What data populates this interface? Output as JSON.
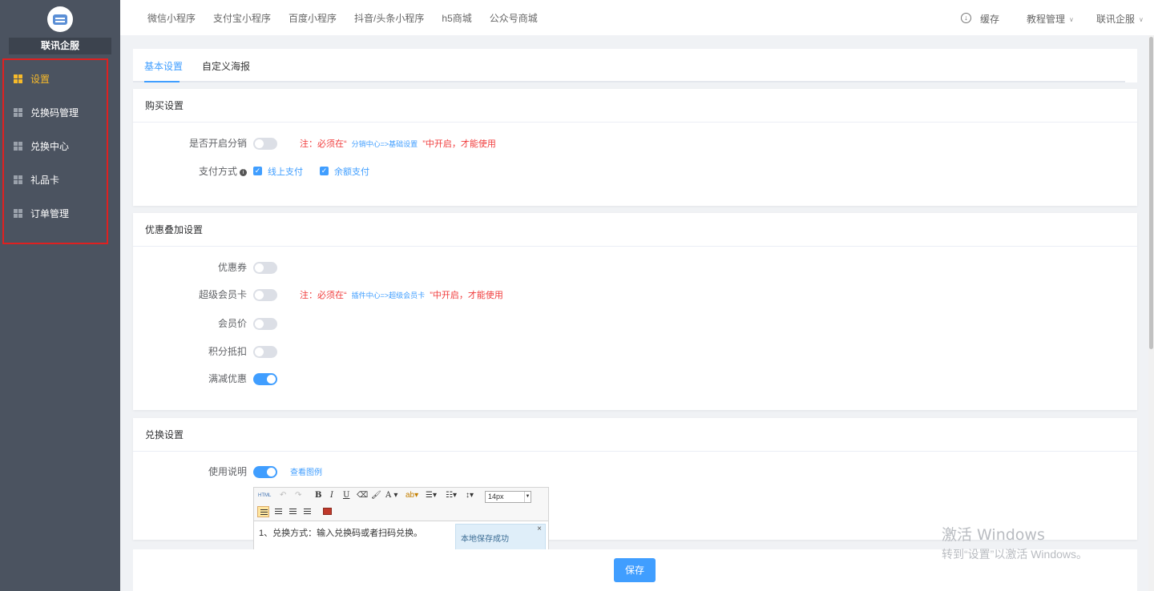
{
  "brand": {
    "name": "联讯企服"
  },
  "sidebar": {
    "items": [
      {
        "label": "设置",
        "active": true
      },
      {
        "label": "兑换码管理"
      },
      {
        "label": "兑换中心"
      },
      {
        "label": "礼品卡"
      },
      {
        "label": "订单管理"
      }
    ]
  },
  "topnav": [
    "微信小程序",
    "支付宝小程序",
    "百度小程序",
    "抖音/头条小程序",
    "h5商城",
    "公众号商城"
  ],
  "topright": {
    "cache": "缓存",
    "tutorial": "教程管理",
    "user": "联讯企服"
  },
  "tabs": [
    "基本设置",
    "自定义海报"
  ],
  "purchase": {
    "title": "购买设置",
    "distribution_label": "是否开启分销",
    "distribution_on": false,
    "note_prefix": "注：必须在“",
    "note_link": "分销中心=>基础设置",
    "note_suffix": "”中开启，才能使用",
    "pay_label": "支付方式",
    "pay_online": "线上支付",
    "pay_balance": "余额支付"
  },
  "discount": {
    "title": "优惠叠加设置",
    "rows": [
      {
        "label": "优惠券",
        "on": false
      },
      {
        "label": "超级会员卡",
        "on": false
      },
      {
        "label": "会员价",
        "on": false
      },
      {
        "label": "积分抵扣",
        "on": false
      },
      {
        "label": "满减优惠",
        "on": true
      }
    ],
    "note_prefix": "注：必须在“",
    "note_link": "插件中心=>超级会员卡",
    "note_suffix": "”中开启，才能使用"
  },
  "exchange": {
    "title": "兑换设置",
    "usage_label": "使用说明",
    "usage_on": true,
    "example_link": "查看图例",
    "editor": {
      "html_btn": "HTML",
      "font_size": "14px",
      "content": "1、兑换方式：输入兑换码或者扫码兑换。",
      "toast": "本地保存成功",
      "toast_close": "×"
    }
  },
  "footer": {
    "save": "保存"
  },
  "watermark": {
    "line1": "激活 Windows",
    "line2": "转到“设置”以激活 Windows。"
  }
}
